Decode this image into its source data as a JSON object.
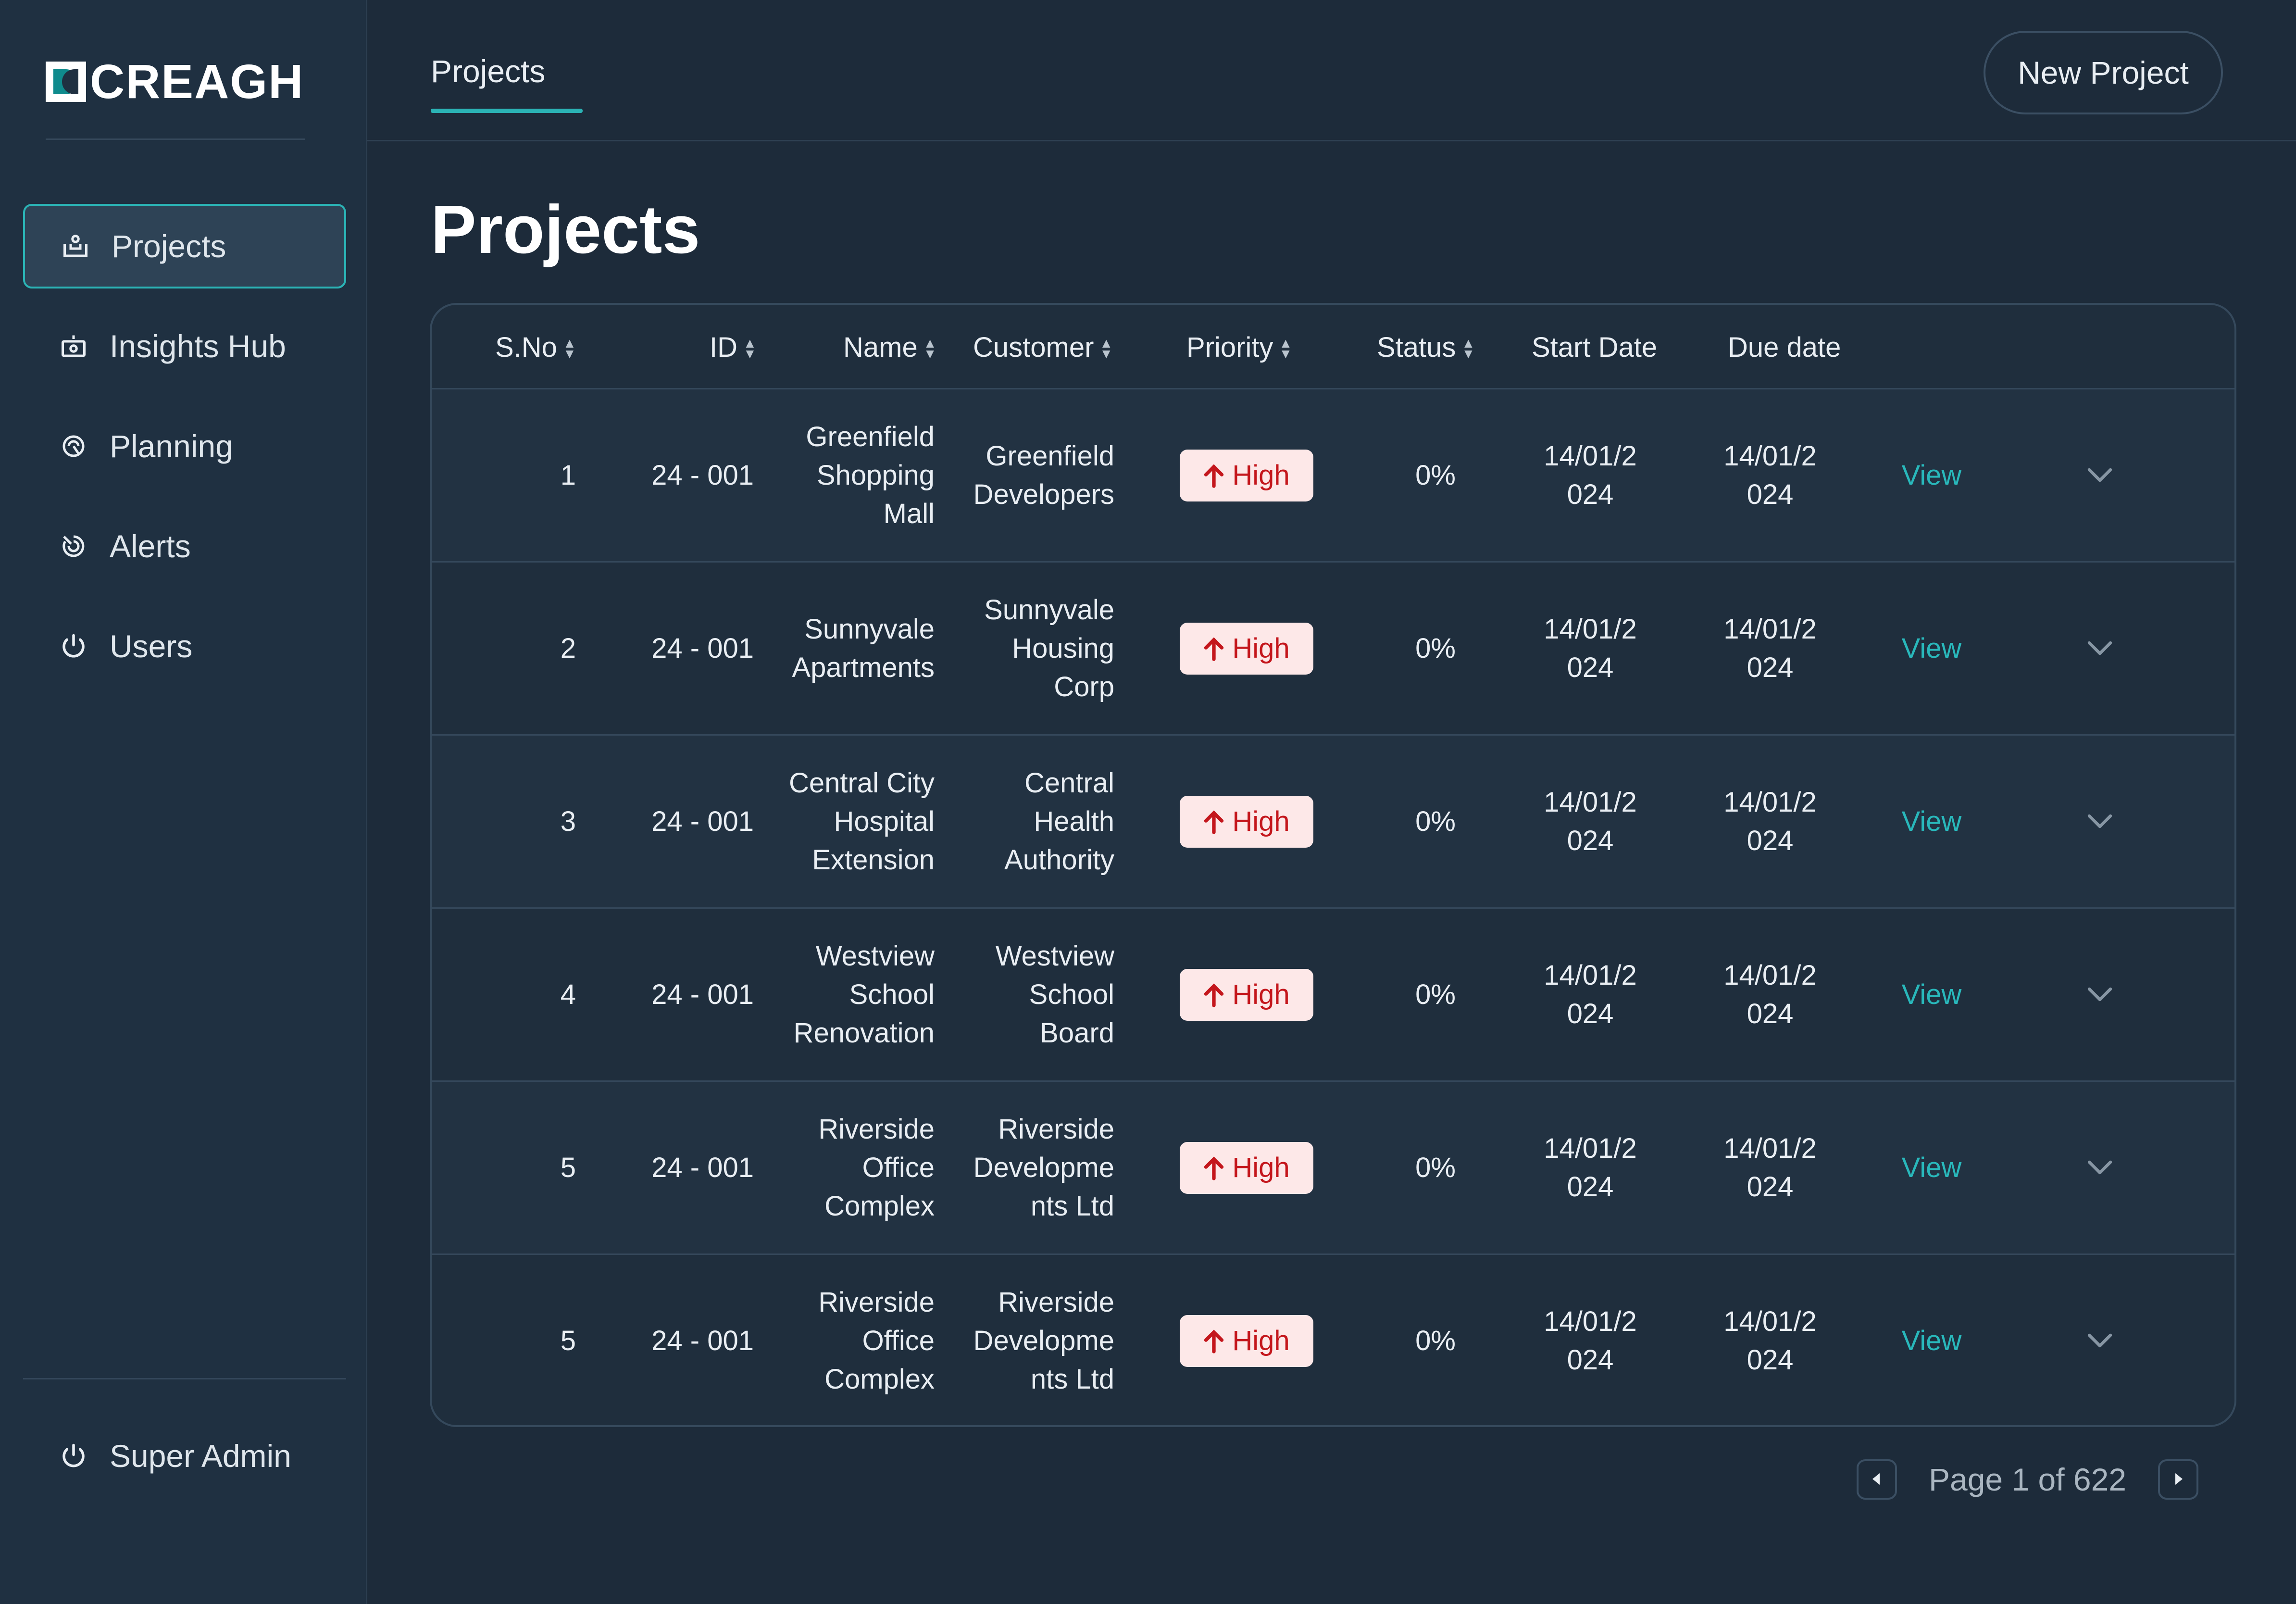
{
  "brand": {
    "name": "CREAGH"
  },
  "sidebar": {
    "items": [
      {
        "label": "Projects",
        "icon": "projects-icon",
        "active": true
      },
      {
        "label": "Insights Hub",
        "icon": "insights-icon",
        "active": false
      },
      {
        "label": "Planning",
        "icon": "planning-icon",
        "active": false
      },
      {
        "label": "Alerts",
        "icon": "alerts-icon",
        "active": false
      },
      {
        "label": "Users",
        "icon": "power-icon",
        "active": false
      }
    ],
    "footer": {
      "label": "Super Admin",
      "icon": "power-icon"
    }
  },
  "header": {
    "tab_label": "Projects",
    "new_project_label": "New Project"
  },
  "page": {
    "title": "Projects"
  },
  "table": {
    "columns": [
      "S.No",
      "ID",
      "Name",
      "Customer",
      "Priority",
      "Status",
      "Start Date",
      "Due date"
    ],
    "rows": [
      {
        "sno": "1",
        "id": "24 - 001",
        "name": [
          "Greenfield",
          "Shopping",
          "Mall"
        ],
        "customer": [
          "Greenfield",
          "Developers"
        ],
        "priority": "High",
        "status": "0%",
        "start": [
          "14/01/2",
          "024"
        ],
        "due": [
          "14/01/2",
          "024"
        ],
        "action": "View"
      },
      {
        "sno": "2",
        "id": "24 - 001",
        "name": [
          "Sunnyvale",
          "Apartments"
        ],
        "customer": [
          "Sunnyvale",
          "Housing",
          "Corp"
        ],
        "priority": "High",
        "status": "0%",
        "start": [
          "14/01/2",
          "024"
        ],
        "due": [
          "14/01/2",
          "024"
        ],
        "action": "View"
      },
      {
        "sno": "3",
        "id": "24 - 001",
        "name": [
          "Central City",
          "Hospital",
          "Extension"
        ],
        "customer": [
          "Central",
          "Health",
          "Authority"
        ],
        "priority": "High",
        "status": "0%",
        "start": [
          "14/01/2",
          "024"
        ],
        "due": [
          "14/01/2",
          "024"
        ],
        "action": "View"
      },
      {
        "sno": "4",
        "id": "24 - 001",
        "name": [
          "Westview",
          "School",
          "Renovation"
        ],
        "customer": [
          "Westview",
          "School",
          "Board"
        ],
        "priority": "High",
        "status": "0%",
        "start": [
          "14/01/2",
          "024"
        ],
        "due": [
          "14/01/2",
          "024"
        ],
        "action": "View"
      },
      {
        "sno": "5",
        "id": "24 - 001",
        "name": [
          "Riverside",
          "Office",
          "Complex"
        ],
        "customer": [
          "Riverside",
          "Developme",
          "nts Ltd"
        ],
        "priority": "High",
        "status": "0%",
        "start": [
          "14/01/2",
          "024"
        ],
        "due": [
          "14/01/2",
          "024"
        ],
        "action": "View"
      },
      {
        "sno": "5",
        "id": "24 - 001",
        "name": [
          "Riverside",
          "Office",
          "Complex"
        ],
        "customer": [
          "Riverside",
          "Developme",
          "nts Ltd"
        ],
        "priority": "High",
        "status": "0%",
        "start": [
          "14/01/2",
          "024"
        ],
        "due": [
          "14/01/2",
          "024"
        ],
        "action": "View"
      }
    ]
  },
  "pagination": {
    "text": "Page 1 of 622"
  },
  "colors": {
    "accent": "#2bb3b5",
    "priority_high_bg": "#fde8e8",
    "priority_high_text": "#c4161c",
    "background": "#1d2b3a"
  }
}
